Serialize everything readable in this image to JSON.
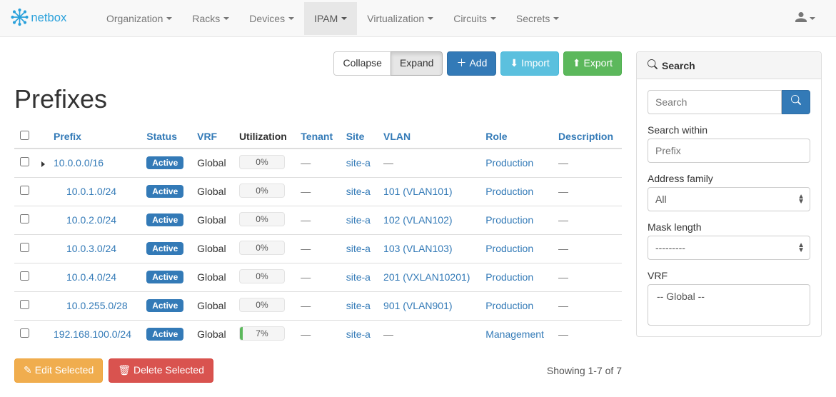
{
  "brand": "netbox",
  "nav": {
    "items": [
      "Organization",
      "Racks",
      "Devices",
      "IPAM",
      "Virtualization",
      "Circuits",
      "Secrets"
    ],
    "active_index": 3
  },
  "page": {
    "title": "Prefixes"
  },
  "top_actions": {
    "collapse": "Collapse",
    "expand": "Expand",
    "add": "Add",
    "import": "Import",
    "export": "Export"
  },
  "columns": {
    "prefix": "Prefix",
    "status": "Status",
    "vrf": "VRF",
    "utilization": "Utilization",
    "tenant": "Tenant",
    "site": "Site",
    "vlan": "VLAN",
    "role": "Role",
    "description": "Description"
  },
  "rows": [
    {
      "prefix": "10.0.0.0/16",
      "expandable": true,
      "indent": 0,
      "status": "Active",
      "vrf": "Global",
      "utilization": "0%",
      "util_pct": 0,
      "tenant": "—",
      "site": "site-a",
      "vlan": "—",
      "role": "Production",
      "description": "—"
    },
    {
      "prefix": "10.0.1.0/24",
      "expandable": false,
      "indent": 1,
      "status": "Active",
      "vrf": "Global",
      "utilization": "0%",
      "util_pct": 0,
      "tenant": "—",
      "site": "site-a",
      "vlan": "101 (VLAN101)",
      "role": "Production",
      "description": "—"
    },
    {
      "prefix": "10.0.2.0/24",
      "expandable": false,
      "indent": 1,
      "status": "Active",
      "vrf": "Global",
      "utilization": "0%",
      "util_pct": 0,
      "tenant": "—",
      "site": "site-a",
      "vlan": "102 (VLAN102)",
      "role": "Production",
      "description": "—"
    },
    {
      "prefix": "10.0.3.0/24",
      "expandable": false,
      "indent": 1,
      "status": "Active",
      "vrf": "Global",
      "utilization": "0%",
      "util_pct": 0,
      "tenant": "—",
      "site": "site-a",
      "vlan": "103 (VLAN103)",
      "role": "Production",
      "description": "—"
    },
    {
      "prefix": "10.0.4.0/24",
      "expandable": false,
      "indent": 1,
      "status": "Active",
      "vrf": "Global",
      "utilization": "0%",
      "util_pct": 0,
      "tenant": "—",
      "site": "site-a",
      "vlan": "201 (VXLAN10201)",
      "role": "Production",
      "description": "—"
    },
    {
      "prefix": "10.0.255.0/28",
      "expandable": false,
      "indent": 1,
      "status": "Active",
      "vrf": "Global",
      "utilization": "0%",
      "util_pct": 0,
      "tenant": "—",
      "site": "site-a",
      "vlan": "901 (VLAN901)",
      "role": "Production",
      "description": "—"
    },
    {
      "prefix": "192.168.100.0/24",
      "expandable": false,
      "indent": 0,
      "status": "Active",
      "vrf": "Global",
      "utilization": "7%",
      "util_pct": 7,
      "tenant": "—",
      "site": "site-a",
      "vlan": "—",
      "role": "Management",
      "description": "—"
    }
  ],
  "footer": {
    "edit_selected": "Edit Selected",
    "delete_selected": "Delete Selected",
    "showing": "Showing 1-7 of 7"
  },
  "search_panel": {
    "heading": "Search",
    "search_placeholder": "Search",
    "within_label": "Search within",
    "within_placeholder": "Prefix",
    "address_family_label": "Address family",
    "address_family_value": "All",
    "mask_length_label": "Mask length",
    "mask_length_value": "---------",
    "vrf_label": "VRF",
    "vrf_value": "-- Global --"
  }
}
